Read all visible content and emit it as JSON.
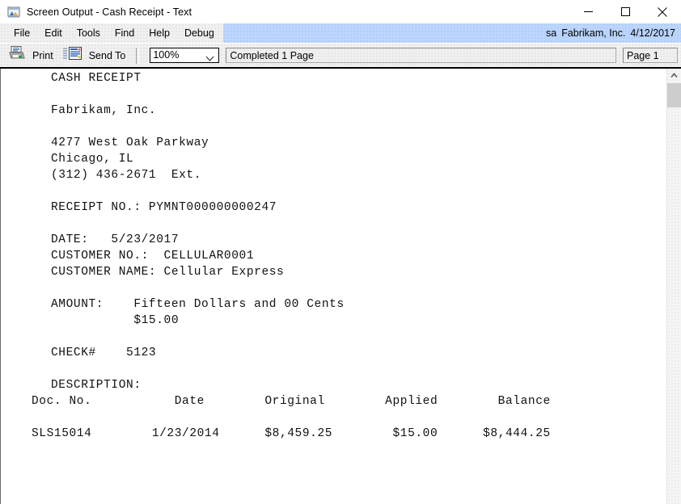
{
  "window": {
    "title": "Screen Output - Cash Receipt - Text",
    "icon": "screen-output-icon",
    "minimize_label": "─",
    "maximize_label": "□",
    "close_label": "✕"
  },
  "menubar": {
    "items": [
      {
        "label": "File"
      },
      {
        "label": "Edit"
      },
      {
        "label": "Tools"
      },
      {
        "label": "Find"
      },
      {
        "label": "Help"
      },
      {
        "label": "Debug"
      }
    ],
    "status": {
      "user": "sa",
      "company": "Fabrikam, Inc.",
      "date": "4/12/2017",
      "background_color": "#bcd6fd"
    }
  },
  "toolbar": {
    "print_label": "Print",
    "print_icon": "printer-icon",
    "send_to_label": "Send To",
    "send_to_icon": "send-to-icon",
    "zoom_value": "100%",
    "zoom_options": [
      "100%"
    ],
    "zoom_chevron_icon": "chevron-down-icon",
    "completion_status": "Completed 1 Page",
    "page_indicator": "Page 1"
  },
  "document": {
    "lines": [
      "CASH RECEIPT",
      "",
      "Fabrikam, Inc.",
      "",
      "4277 West Oak Parkway",
      "Chicago, IL",
      "(312) 436-2671  Ext.",
      "",
      "RECEIPT NO.: PYMNT000000000247",
      "",
      "DATE:   5/23/2017",
      "CUSTOMER NO.:  CELLULAR0001",
      "CUSTOMER NAME: Cellular Express",
      "",
      "AMOUNT:    Fifteen Dollars and 00 Cents",
      "           $15.00",
      "",
      "CHECK#    5123",
      "",
      "DESCRIPTION:"
    ],
    "table": {
      "header": "Doc. No.           Date        Original        Applied        Balance",
      "rows": [
        "SLS15014        1/23/2014      $8,459.25        $15.00      $8,444.25"
      ]
    }
  },
  "scrollbar": {
    "up_arrow_icon": "scroll-up-arrow-icon",
    "thumb": "vertical-scroll-thumb"
  }
}
